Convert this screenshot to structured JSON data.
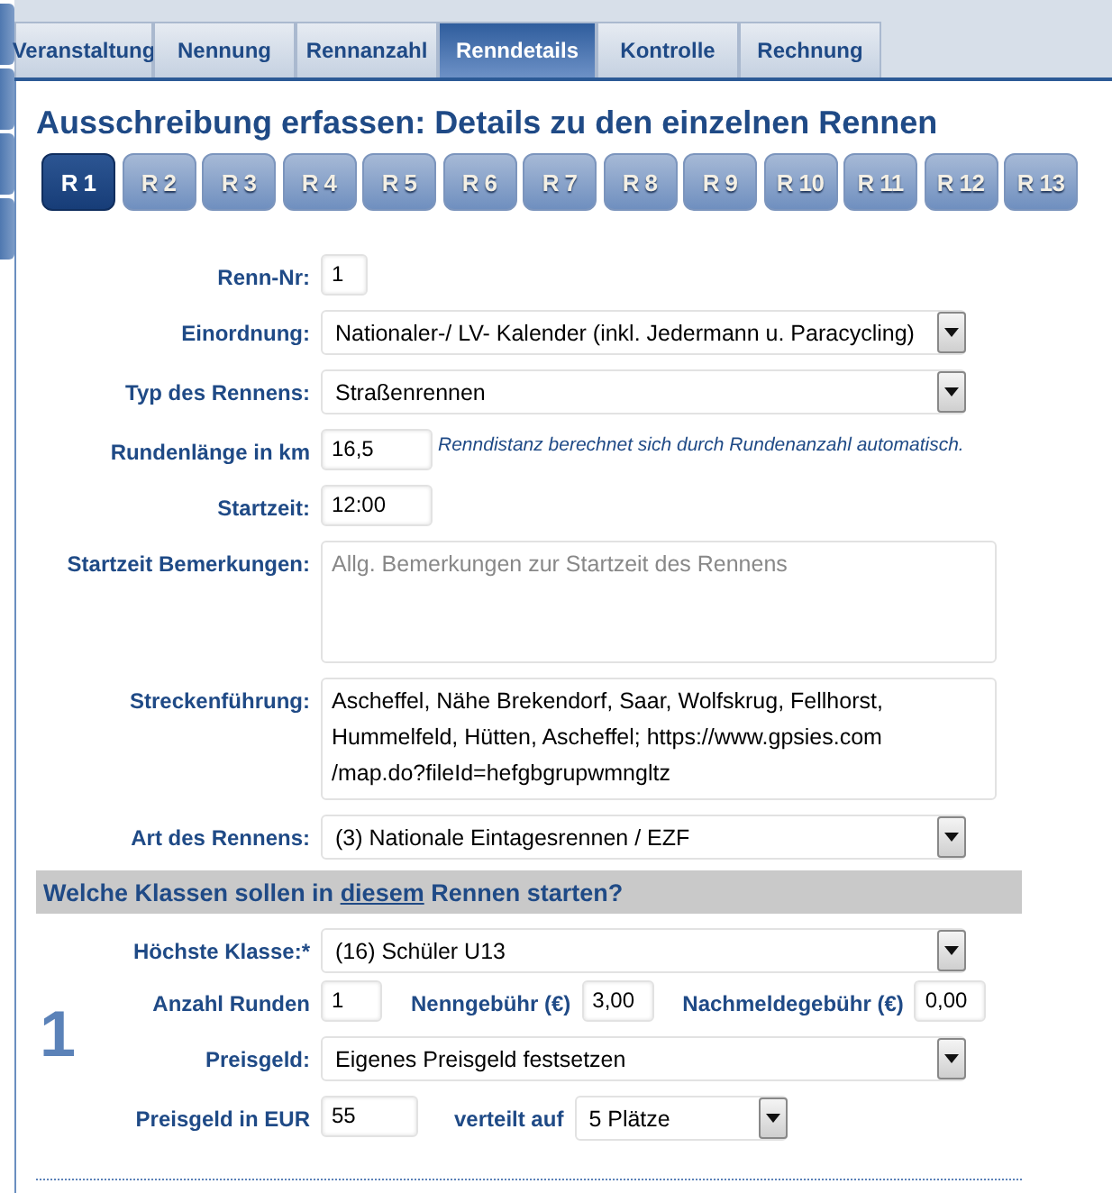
{
  "tabs": [
    {
      "label": "Veranstaltung",
      "selected": false
    },
    {
      "label": "Nennung",
      "selected": false
    },
    {
      "label": "Rennanzahl",
      "selected": false
    },
    {
      "label": "Renndetails",
      "selected": true
    },
    {
      "label": "Kontrolle",
      "selected": false
    },
    {
      "label": "Rechnung",
      "selected": false
    }
  ],
  "heading": "Ausschreibung erfassen: Details zu den einzelnen Rennen",
  "races": [
    {
      "label": "R 1",
      "selected": true
    },
    {
      "label": "R 2",
      "selected": false
    },
    {
      "label": "R 3",
      "selected": false
    },
    {
      "label": "R 4",
      "selected": false
    },
    {
      "label": "R 5",
      "selected": false
    },
    {
      "label": "R 6",
      "selected": false
    },
    {
      "label": "R 7",
      "selected": false
    },
    {
      "label": "R 8",
      "selected": false
    },
    {
      "label": "R 9",
      "selected": false
    },
    {
      "label": "R 10",
      "selected": false
    },
    {
      "label": "R 11",
      "selected": false
    },
    {
      "label": "R 12",
      "selected": false
    },
    {
      "label": "R 13",
      "selected": false
    }
  ],
  "fields": [
    {
      "kind": "short",
      "label": "Renn-Nr:",
      "value": "1"
    },
    {
      "kind": "select",
      "label": "Einordnung:",
      "value": "Nationaler-/ LV- Kalender (inkl. Jedermann u. Paracycling)"
    },
    {
      "kind": "select",
      "label": "Typ des Rennens:",
      "value": "Straßenrennen"
    },
    {
      "kind": "medium",
      "label": "Rundenlänge in km",
      "value": "16,5",
      "note": "Renndistanz berechnet sich durch Rundenanzahl automatisch."
    },
    {
      "kind": "medium",
      "label": "Startzeit:",
      "value": "12:00"
    },
    {
      "kind": "textarea",
      "label": "Startzeit Bemerkungen:",
      "placeholder": "Allg. Bemerkungen zur Startzeit des Rennens"
    },
    {
      "kind": "textarea",
      "label": "Streckenführung:",
      "value": "Ascheffel, Nähe Brekendorf, Saar, Wolfskrug, Fellhorst, Hummelfeld, Hütten, Ascheffel; https://www.gpsies.com /map.do?fileId=hefgbgrupwmngltz"
    },
    {
      "kind": "select",
      "label": "Art des Rennens:",
      "value": "(3) Nationale Eintagesrennen / EZF"
    }
  ],
  "section": {
    "parts": [
      {
        "text": "Welche Klassen sollen in ",
        "underlined": false
      },
      {
        "text": "diesem",
        "underlined": true
      },
      {
        "text": " Rennen starten?",
        "underlined": false
      }
    ]
  },
  "class_block": {
    "number": "1",
    "top_class": {
      "label": "Höchste Klasse:*",
      "value": "(16) Schüler U13"
    },
    "laps": {
      "label": "Anzahl Runden",
      "value": "1"
    },
    "fee": {
      "label": "Nenngebühr (€)",
      "value": "3,00"
    },
    "late_fee": {
      "label": "Nachmeldegebühr (€)",
      "value": "0,00"
    },
    "prize": {
      "label": "Preisgeld:",
      "value": "Eigenes Preisgeld festsetzen"
    },
    "prize_eur": {
      "label": "Preisgeld in EUR",
      "value": "55"
    },
    "spread": {
      "label": "verteilt auf",
      "value": "5 Plätze"
    }
  }
}
